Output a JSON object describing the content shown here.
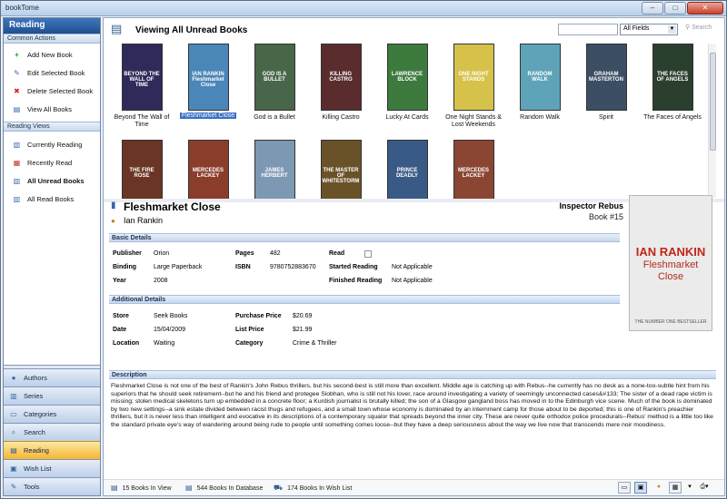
{
  "window": {
    "title": "bookTome",
    "min": "–",
    "max": "□",
    "close": "✕"
  },
  "sidebar": {
    "header": "Reading",
    "common_actions_label": "Common Actions",
    "common_actions": [
      {
        "label": "Add New Book",
        "icon": "plus-icon"
      },
      {
        "label": "Edit Selected Book",
        "icon": "edit-icon"
      },
      {
        "label": "Delete Selected Book",
        "icon": "delete-icon"
      },
      {
        "label": "View All Books",
        "icon": "books-icon"
      }
    ],
    "reading_views_label": "Reading Views",
    "reading_views": [
      {
        "label": "Currently Reading",
        "icon": "book-icon"
      },
      {
        "label": "Recently Read",
        "icon": "calendar-icon"
      },
      {
        "label": "All Unread Books",
        "icon": "book-icon"
      },
      {
        "label": "All Read Books",
        "icon": "book-icon"
      }
    ],
    "nav": [
      {
        "label": "Authors",
        "icon": "person-icon"
      },
      {
        "label": "Series",
        "icon": "series-icon"
      },
      {
        "label": "Categories",
        "icon": "folder-icon"
      },
      {
        "label": "Search",
        "icon": "search-icon"
      },
      {
        "label": "Reading",
        "icon": "reading-icon"
      },
      {
        "label": "Wish List",
        "icon": "wishlist-icon"
      },
      {
        "label": "Tools",
        "icon": "tools-icon"
      }
    ]
  },
  "header": {
    "title": "Viewing All Unread Books",
    "search_field": "All Fields",
    "search_button": "Search"
  },
  "books": [
    {
      "title": "Beyond The Wall of Time",
      "cover_text": "BEYOND THE WALL OF TIME",
      "color": "#2e2a5a"
    },
    {
      "title": "Fleshmarket Close",
      "cover_text": "IAN RANKIN Fleshmarket Close",
      "color": "#4a86b8"
    },
    {
      "title": "God is a Bullet",
      "cover_text": "GOD IS A BULLET",
      "color": "#48664a"
    },
    {
      "title": "Killing Castro",
      "cover_text": "KILLING CASTRO",
      "color": "#5a2c2e"
    },
    {
      "title": "Lucky At Cards",
      "cover_text": "LAWRENCE BLOCK",
      "color": "#3c7a3e"
    },
    {
      "title": "One Night Stands & Lost Weekends",
      "cover_text": "ONE NIGHT STANDS",
      "color": "#d6c24a"
    },
    {
      "title": "Random Walk",
      "cover_text": "RANDOM WALK",
      "color": "#5fa3b8"
    },
    {
      "title": "Spirit",
      "cover_text": "GRAHAM MASTERTON",
      "color": "#3b4e63"
    },
    {
      "title": "The Faces of Angels",
      "cover_text": "THE FACES OF ANGELS",
      "color": "#2b3f2e"
    },
    {
      "title": "",
      "cover_text": "THE FIRE ROSE",
      "color": "#6a3524"
    },
    {
      "title": "",
      "cover_text": "MERCEDES LACKEY",
      "color": "#8b3d2c"
    },
    {
      "title": "",
      "cover_text": "JAMES HERBERT",
      "color": "#7c98b3"
    },
    {
      "title": "",
      "cover_text": "THE MASTER OF WHITESTORM",
      "color": "#6a5228"
    },
    {
      "title": "",
      "cover_text": "PRINCE DEADLY",
      "color": "#3a5a86"
    },
    {
      "title": "",
      "cover_text": "MERCEDES LACKEY",
      "color": "#8a4632"
    }
  ],
  "detail": {
    "title": "Fleshmarket Close",
    "author": "Ian Rankin",
    "series": "Inspector Rebus",
    "series_number": "Book #15",
    "basic_label": "Basic Details",
    "basic": {
      "publisher_label": "Publisher",
      "publisher": "Orion",
      "binding_label": "Binding",
      "binding": "Large Paperback",
      "year_label": "Year",
      "year": "2008",
      "pages_label": "Pages",
      "pages": "482",
      "isbn_label": "ISBN",
      "isbn": "9780752883670",
      "read_label": "Read",
      "started_label": "Started Reading",
      "started": "Not Applicable",
      "finished_label": "Finished Reading",
      "finished": "Not Applicable"
    },
    "additional_label": "Additional Details",
    "additional": {
      "store_label": "Store",
      "store": "Seek Books",
      "date_label": "Date",
      "date": "15/04/2009",
      "location_label": "Location",
      "location": "Waiting",
      "purchase_label": "Purchase Price",
      "purchase": "$20.69",
      "list_label": "List Price",
      "list": "$21.99",
      "category_label": "Category",
      "category": "Crime & Thriller"
    },
    "cover": {
      "author": "IAN RANKIN",
      "title1": "Fleshmarket",
      "title2": "Close",
      "banner": "THE NUMBER ONE BESTSELLER"
    },
    "description_label": "Description",
    "description": "Fleshmarket Close is not one of the best of Rankin's John Rebus thrillers, but his second-best is still more than excellent. Middle age is catching up with Rebus--he currently has no desk as a none-too-subtle hint from his superiors that he should seek retirement--but he and his friend and protegee Siobhan, who is still not his lover, race around investigating a variety of seemingly unconnected cases&#133; The sister of a dead rape victim is missing; stolen medical skeletons turn up embedded in a concrete floor; a Kurdish journalist is brutally killed; the son of a Glasgow gangland boss has moved in to the Edinburgh vice scene. Much of the book is dominated by two new settings--a sink estate divided between racist thugs and refugees, and a small town whose economy is dominated by an internment camp for those about to be deported; this is one of Rankin's preachier thrillers, but it is never less than intelligent and evocative in its descriptions of a contemporary squalor that spreads beyond the inner city. These are never quite orthodox police procedurals--Rebus' method is a little too like the standard private eye's way of wandering around being rude to people until something comes loose--but they have a deep seriousness about the way we live now that transcends mere noir moodiness."
  },
  "status": {
    "in_view": "15 Books In View",
    "in_database": "544 Books In Database",
    "in_wishlist": "174 Books In Wish List"
  }
}
